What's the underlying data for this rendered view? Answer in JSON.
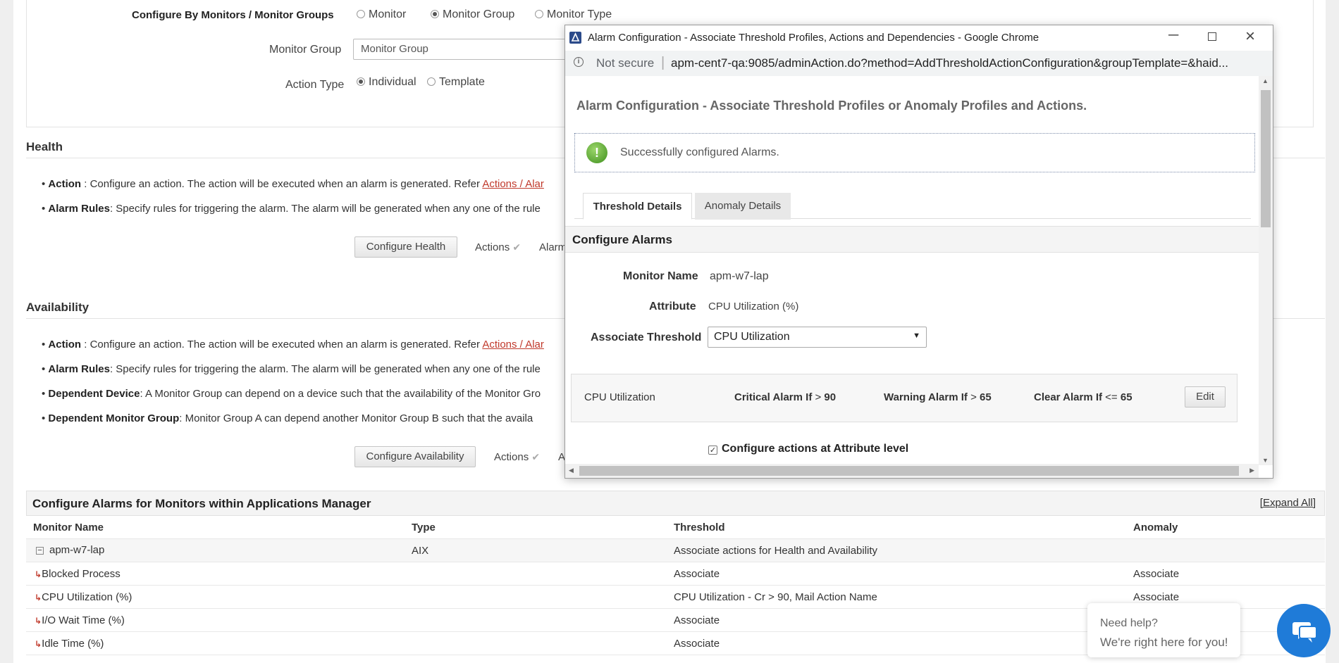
{
  "configure_by": {
    "label": "Configure By Monitors / Monitor Groups",
    "options": [
      "Monitor",
      "Monitor Group",
      "Monitor Type"
    ],
    "selected": "Monitor Group"
  },
  "monitor_group": {
    "label": "Monitor Group",
    "value": "Monitor Group"
  },
  "action_type": {
    "label": "Action Type",
    "options": [
      "Individual",
      "Template"
    ],
    "selected": "Individual"
  },
  "health": {
    "title": "Health",
    "action_label": "Action",
    "action_text": " : Configure an action. The action will be executed when an alarm is generated. Refer ",
    "action_link": "Actions / Alar",
    "rules_label": "Alarm Rules",
    "rules_text": ": Specify rules for triggering the alarm. The alarm will be generated when any one of the rule",
    "button": "Configure Health",
    "actions_label": "Actions",
    "alarm_label": "Alarm"
  },
  "availability": {
    "title": "Availability",
    "action_label": "Action",
    "action_text": " : Configure an action. The action will be executed when an alarm is generated. Refer ",
    "action_link": "Actions / Alar",
    "rules_label": "Alarm Rules",
    "rules_text": ": Specify rules for triggering the alarm. The alarm will be generated when any one of the rule",
    "dep_device_label": "Dependent Device",
    "dep_device_text": ": A Monitor Group can depend on a device such that the availability of the Monitor Gro",
    "dep_group_label": "Dependent Monitor Group",
    "dep_group_text": ": Monitor Group A can depend another Monitor Group B such that the availa",
    "button": "Configure Availability",
    "actions_label": "Actions",
    "alarm_label": "A"
  },
  "table": {
    "title": "Configure Alarms for Monitors within Applications Manager",
    "expand_all": "[Expand All]",
    "columns": [
      "Monitor Name",
      "Type",
      "Threshold",
      "Anomaly"
    ],
    "group_row": {
      "name": "apm-w7-lap",
      "type": "AIX",
      "threshold": "Associate actions for Health and Availability",
      "anomaly": ""
    },
    "rows": [
      {
        "name": "Blocked Process",
        "threshold": "Associate",
        "anomaly": "Associate"
      },
      {
        "name": "CPU Utilization (%)",
        "threshold": "CPU Utilization - Cr > 90, Mail Action Name",
        "anomaly": "Associate"
      },
      {
        "name": "I/O Wait Time (%)",
        "threshold": "Associate",
        "anomaly": ""
      },
      {
        "name": "Idle Time (%)",
        "threshold": "Associate",
        "anomaly": ""
      }
    ]
  },
  "popup": {
    "window_title": "Alarm Configuration - Associate Threshold Profiles, Actions and Dependencies - Google Chrome",
    "not_secure": "Not secure",
    "url": "apm-cent7-qa:9085/adminAction.do?method=AddThresholdActionConfiguration&groupTemplate=&haid...",
    "heading": "Alarm Configuration - Associate Threshold Profiles or Anomaly Profiles and Actions.",
    "success_msg": "Successfully configured Alarms.",
    "tabs": [
      "Threshold Details",
      "Anomaly Details"
    ],
    "section": "Configure Alarms",
    "monitor_name_label": "Monitor Name",
    "monitor_name": "apm-w7-lap",
    "attribute_label": "Attribute",
    "attribute": "CPU Utilization (%)",
    "associate_label": "Associate Threshold",
    "associate_value": "CPU Utilization",
    "threshold_box": {
      "name": "CPU Utilization",
      "critical_label": "Critical Alarm If",
      "critical_op": ">",
      "critical_val": "90",
      "warning_label": "Warning Alarm If",
      "warning_op": ">",
      "warning_val": "65",
      "clear_label": "Clear Alarm If",
      "clear_op": "<=",
      "clear_val": "65",
      "edit": "Edit"
    },
    "attr_level_label": "Configure actions at Attribute level"
  },
  "chat": {
    "line1": "Need help?",
    "line2": "We're right here for you!"
  }
}
